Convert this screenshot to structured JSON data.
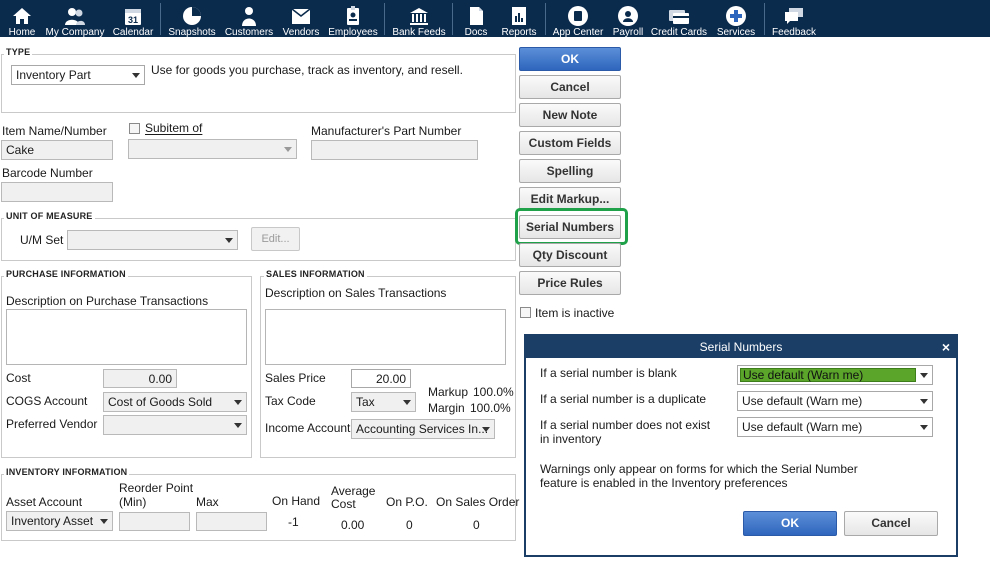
{
  "toolbar": {
    "items": [
      {
        "label": "Home",
        "icon": "home-icon"
      },
      {
        "label": "My Company",
        "icon": "company-icon"
      },
      {
        "label": "Calendar",
        "icon": "calendar-icon"
      },
      {
        "label": "Snapshots",
        "icon": "snapshots-icon"
      },
      {
        "label": "Customers",
        "icon": "customers-icon"
      },
      {
        "label": "Vendors",
        "icon": "vendors-icon"
      },
      {
        "label": "Employees",
        "icon": "employees-icon"
      },
      {
        "label": "Bank Feeds",
        "icon": "bank-icon"
      },
      {
        "label": "Docs",
        "icon": "docs-icon"
      },
      {
        "label": "Reports",
        "icon": "reports-icon"
      },
      {
        "label": "App Center",
        "icon": "app-center-icon"
      },
      {
        "label": "Payroll",
        "icon": "payroll-icon"
      },
      {
        "label": "Credit Cards",
        "icon": "credit-cards-icon"
      },
      {
        "label": "Services",
        "icon": "services-icon"
      },
      {
        "label": "Feedback",
        "icon": "feedback-icon"
      }
    ],
    "calendar_day": "31"
  },
  "type_section": {
    "title": "TYPE",
    "selected": "Inventory Part",
    "description": "Use for goods you purchase, track as inventory, and resell."
  },
  "item": {
    "name_label": "Item Name/Number",
    "name_value": "Cake",
    "subitem_label": "Subitem of",
    "subitem_checked": false,
    "mfr_label": "Manufacturer's Part Number",
    "mfr_value": "",
    "barcode_label": "Barcode Number",
    "barcode_value": ""
  },
  "uom": {
    "title": "UNIT OF MEASURE",
    "set_label": "U/M Set",
    "set_value": "",
    "edit_label": "Edit..."
  },
  "purchase": {
    "title": "PURCHASE INFORMATION",
    "desc_label": "Description on Purchase Transactions",
    "desc_value": "",
    "cost_label": "Cost",
    "cost_value": "0.00",
    "cogs_label": "COGS Account",
    "cogs_value": "Cost of Goods Sold",
    "vendor_label": "Preferred Vendor",
    "vendor_value": ""
  },
  "sales": {
    "title": "SALES INFORMATION",
    "desc_label": "Description on Sales Transactions",
    "desc_value": "",
    "price_label": "Sales Price",
    "price_value": "20.00",
    "tax_label": "Tax Code",
    "tax_value": "Tax",
    "markup_label": "Markup",
    "markup_value": "100.0%",
    "margin_label": "Margin",
    "margin_value": "100.0%",
    "income_label": "Income Account",
    "income_value": "Accounting Services In..."
  },
  "inventory": {
    "title": "INVENTORY INFORMATION",
    "asset_label": "Asset Account",
    "asset_value": "Inventory Asset",
    "reorder_label_1": "Reorder Point",
    "reorder_label_2": "(Min)",
    "max_label": "Max",
    "onhand_label": "On Hand",
    "onhand_value": "-1",
    "avgcost_label_1": "Average",
    "avgcost_label_2": "Cost",
    "avgcost_value": "0.00",
    "onpo_label": "On P.O.",
    "onpo_value": "0",
    "onsales_label": "On Sales Order",
    "onsales_value": "0"
  },
  "buttons": {
    "ok": "OK",
    "cancel": "Cancel",
    "new_note": "New Note",
    "custom_fields": "Custom Fields",
    "spelling": "Spelling",
    "edit_markup": "Edit Markup...",
    "serial_numbers": "Serial Numbers",
    "qty_discount": "Qty Discount",
    "price_rules": "Price Rules",
    "inactive_label": "Item is inactive"
  },
  "dialog": {
    "title": "Serial Numbers",
    "close": "×",
    "rows": [
      {
        "label": "If a serial number is blank",
        "value": "Use default (Warn me)"
      },
      {
        "label": "If a serial number is a duplicate",
        "value": "Use default (Warn me)"
      },
      {
        "label_1": "If a serial number does not exist",
        "label_2": "in inventory",
        "value": "Use default (Warn me)"
      }
    ],
    "note_1": "Warnings only appear on forms for which the Serial Number",
    "note_2": "feature is enabled in the Inventory preferences",
    "ok": "OK",
    "cancel": "Cancel"
  },
  "colors": {
    "toolbar_bg": "#0b2b4d",
    "primary_button": "#2f66bd",
    "highlight": "#1fa14a",
    "selected_option": "#5aa52a",
    "dialog_title_bg": "#1b3e66"
  }
}
